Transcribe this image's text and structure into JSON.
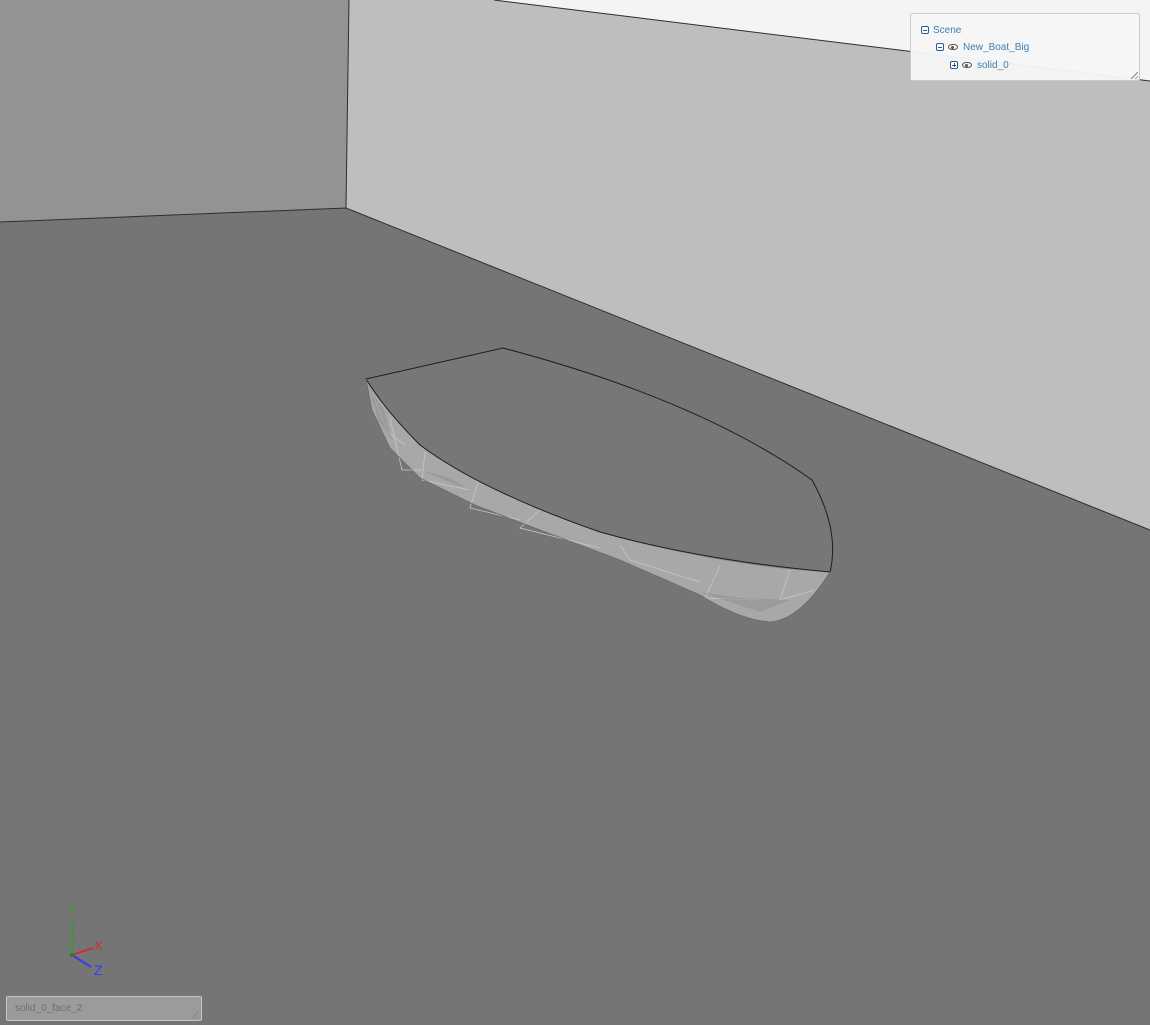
{
  "scene_tree": {
    "root": {
      "label": "Scene",
      "expanded": true
    },
    "items": [
      {
        "label": "New_Boat_Big",
        "expanded": true,
        "visible": true
      },
      {
        "label": "solid_0",
        "expanded": false,
        "visible": true
      }
    ]
  },
  "axes": {
    "x_label": "X",
    "y_label": "Y",
    "z_label": "Z"
  },
  "status": {
    "selection": "solid_0_face_2"
  },
  "colors": {
    "floor": "#757575",
    "left_wall": "#939393",
    "back_wall": "#bebebe",
    "ceiling": "#f4f4f4",
    "hull_deck": "#777777",
    "hull_side": "#a5a5a5",
    "x_axis": "#d03030",
    "y_axis": "#3a9a3a",
    "z_axis": "#3a3af0"
  }
}
